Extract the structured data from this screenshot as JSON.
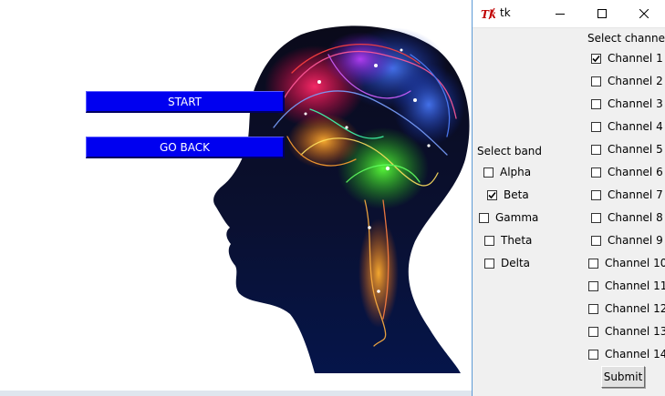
{
  "background_app": {
    "start_label": "START",
    "go_back_label": "GO BACK",
    "button_color": "#0000f0"
  },
  "tk_window": {
    "title": "tk",
    "logo_icon": "tk-feather-logo-icon",
    "band_section": {
      "label": "Select band",
      "items": [
        {
          "label": "Alpha",
          "checked": false
        },
        {
          "label": "Beta",
          "checked": true
        },
        {
          "label": "Gamma",
          "checked": false
        },
        {
          "label": "Theta",
          "checked": false
        },
        {
          "label": "Delta",
          "checked": false
        }
      ]
    },
    "channel_section": {
      "label": "Select channel",
      "items": [
        {
          "label": "Channel 1",
          "checked": true
        },
        {
          "label": "Channel 2",
          "checked": false
        },
        {
          "label": "Channel 3",
          "checked": false
        },
        {
          "label": "Channel 4",
          "checked": false
        },
        {
          "label": "Channel 5",
          "checked": false
        },
        {
          "label": "Channel 6",
          "checked": false
        },
        {
          "label": "Channel 7",
          "checked": false
        },
        {
          "label": "Channel 8",
          "checked": false
        },
        {
          "label": "Channel 9",
          "checked": false
        },
        {
          "label": "Channel 10",
          "checked": false
        },
        {
          "label": "Channel 11",
          "checked": false
        },
        {
          "label": "Channel 12",
          "checked": false
        },
        {
          "label": "Channel 13",
          "checked": false
        },
        {
          "label": "Channel 14",
          "checked": false
        }
      ]
    },
    "submit_label": "Submit",
    "border_color": "#5d9ad6"
  }
}
